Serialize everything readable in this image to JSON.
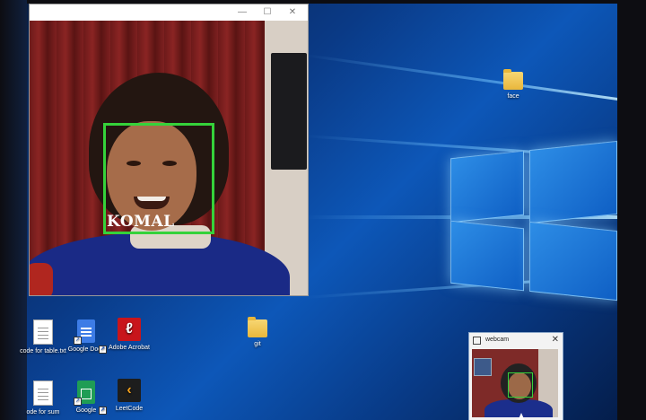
{
  "camera_window": {
    "buttons": {
      "minimize_glyph": "—",
      "maximize_glyph": "☐",
      "close_glyph": "✕"
    },
    "detected_face_label": "KOMAL",
    "box_color": "#35d23a"
  },
  "desktop_icons": [
    {
      "label": "face",
      "icon": "folder-icon"
    },
    {
      "label": "git",
      "icon": "file-icon"
    },
    {
      "label": "code for table.txt",
      "icon": "text-file-icon"
    },
    {
      "label": "Google Docs",
      "icon": "google-docs-icon"
    },
    {
      "label": "Adobe Acrobat",
      "icon": "acrobat-icon"
    },
    {
      "label": "ode for sum",
      "icon": "text-file-icon"
    },
    {
      "label": "Google",
      "icon": "google-sheets-icon"
    },
    {
      "label": "LeetCode",
      "icon": "leetcode-icon"
    }
  ],
  "webcam_window": {
    "title": "webcam",
    "close_glyph": "✕"
  }
}
